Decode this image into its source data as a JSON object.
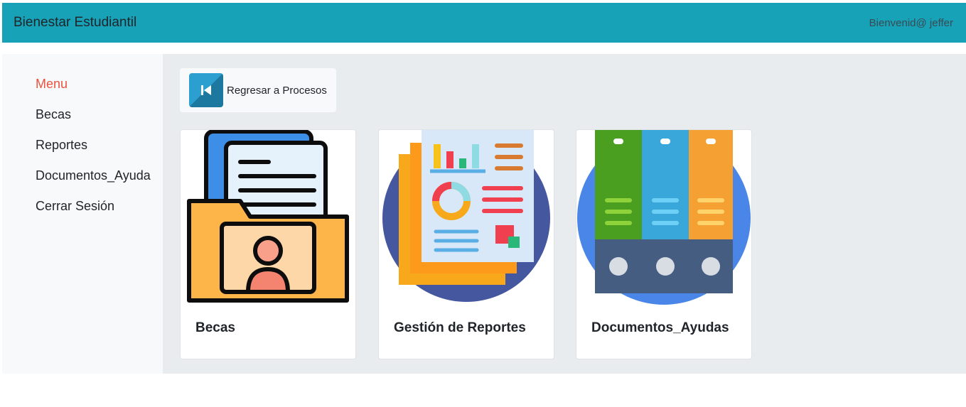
{
  "header": {
    "brand": "Bienestar Estudiantil",
    "welcome": "Bienvenid@ jeffer",
    "bg_color": "#17a2b8"
  },
  "sidebar": {
    "items": [
      {
        "label": "Menu",
        "icon": "",
        "active": true,
        "color": "#e8533f"
      },
      {
        "label": "Becas"
      },
      {
        "label": "Reportes"
      },
      {
        "label": "Documentos_Ayuda"
      },
      {
        "label": "Cerrar Sesión"
      }
    ]
  },
  "main": {
    "back_button": {
      "label": "Regresar a Procesos",
      "icon": "skip-back-icon"
    },
    "cards": [
      {
        "title": "Becas",
        "icon": "folder-student-icon"
      },
      {
        "title": "Gestión de Reportes",
        "icon": "reports-chart-icon"
      },
      {
        "title": "Documentos_Ayudas",
        "icon": "binders-icon"
      }
    ]
  }
}
